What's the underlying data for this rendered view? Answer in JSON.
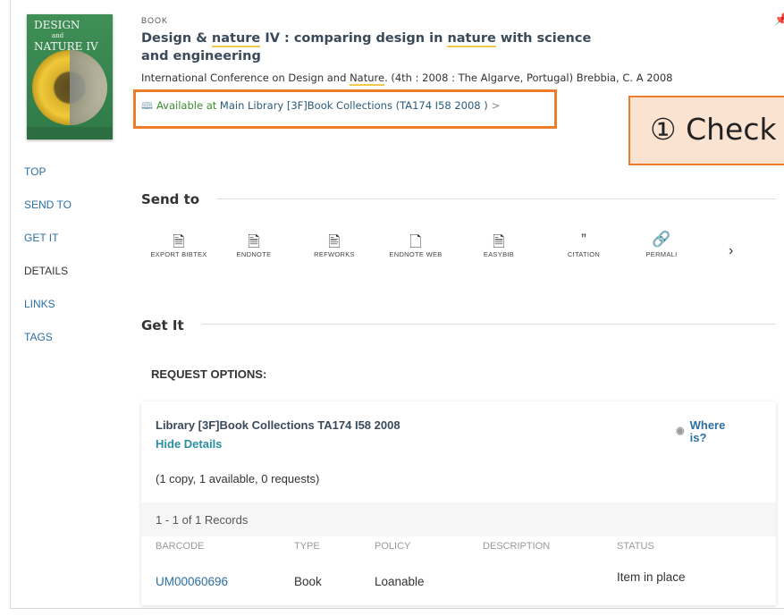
{
  "record": {
    "type": "BOOK",
    "title_parts": [
      "Design & ",
      "nature",
      " IV : comparing design in ",
      "nature",
      " with science and engineering"
    ],
    "authors_parts": [
      "International Conference on Design and ",
      "Nature",
      ". (4th : 2008 : The Algarve, Portugal) Brebbia, C. A 2008"
    ],
    "cover": {
      "line1": "DESIGN",
      "line2": "and",
      "line3": "NATURE IV"
    },
    "availability": {
      "status": "Available at",
      "location": "Main Library  [3F]Book Collections (TA174 I58 2008 )",
      "chevron": ">"
    }
  },
  "callout": {
    "text": "① Check"
  },
  "nav": {
    "items": [
      "TOP",
      "SEND TO",
      "GET IT",
      "DETAILS",
      "LINKS",
      "TAGS"
    ]
  },
  "send_to": {
    "title": "Send to",
    "actions": [
      {
        "label": "EXPORT BIBTEX",
        "icon": "export-bibtex-icon"
      },
      {
        "label": "ENDNOTE",
        "icon": "endnote-icon"
      },
      {
        "label": "REFWORKS",
        "icon": "refworks-icon"
      },
      {
        "label": "ENDNOTE WEB",
        "icon": "endnote-web-icon"
      },
      {
        "label": "EASYBIB",
        "icon": "easybib-icon"
      },
      {
        "label": "CITATION",
        "icon": "citation-icon"
      },
      {
        "label": "PERMALI",
        "icon": "permalink-icon"
      }
    ],
    "next": "›"
  },
  "get_it": {
    "title": "Get It",
    "request_options": "REQUEST OPTIONS:",
    "location_line": "Library   [3F]Book Collections   TA174 I58 2008",
    "hide_details": "Hide Details",
    "where_is": "Where is?",
    "copies": "(1 copy, 1 available, 0 requests)",
    "records": "1 - 1 of 1 Records",
    "columns": [
      "BARCODE",
      "TYPE",
      "POLICY",
      "DESCRIPTION",
      "STATUS"
    ],
    "rows": [
      {
        "barcode": "UM00060696",
        "type": "Book",
        "policy": "Loanable",
        "description": "",
        "status": "Item in place"
      }
    ]
  },
  "colors": {
    "accent": "#ee7d2a",
    "link": "#2c6fa3",
    "available": "#3c8d2f",
    "highlight": "#f2c94c"
  }
}
